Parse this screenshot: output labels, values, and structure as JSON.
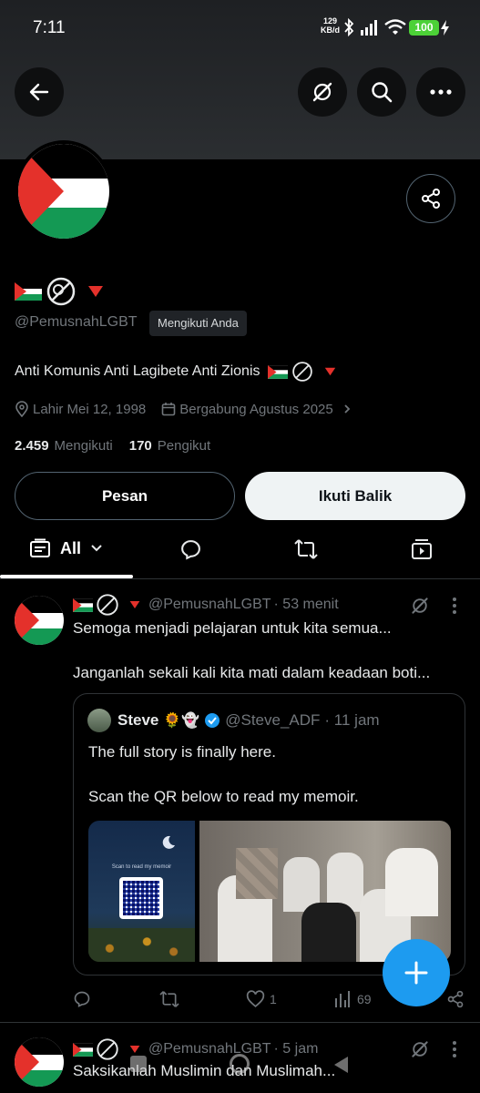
{
  "status_bar": {
    "time": "7:11",
    "net_speed": "129",
    "net_unit": "KB/d",
    "battery": "100"
  },
  "header": {
    "back_icon": "arrow-left-icon",
    "grok_icon": "grok-icon",
    "search_icon": "search-icon",
    "more_icon": "more-horizontal-icon"
  },
  "profile": {
    "handle": "@PemusnahLGBT",
    "follows_you": "Mengikuti Anda",
    "bio": "Anti Komunis Anti Lagibete Anti Zionis",
    "birth": "Lahir Mei 12, 1998",
    "joined": "Bergabung Agustus 2025",
    "following_count": "2.459",
    "following_label": "Mengikuti",
    "followers_count": "170",
    "followers_label": "Pengikut",
    "message_button": "Pesan",
    "follow_back_button": "Ikuti Balik"
  },
  "tabs": {
    "all_label": "All"
  },
  "posts": [
    {
      "handle": "@PemusnahLGBT",
      "time": "· 53 menit",
      "line1": "Semoga menjadi pelajaran untuk kita semua...",
      "line2": "Janganlah sekali kali kita mati dalam keadaan boti...",
      "quote": {
        "name": "Steve",
        "emojis": "🌻👻",
        "handle": "@Steve_ADF",
        "time": "· 11 jam",
        "line1": "The full story is finally here.",
        "line2": "Scan the QR below to read my memoir.",
        "qr_caption": "Scan to read my memoir"
      },
      "actions": {
        "reply": "",
        "repost": "",
        "likes": "1",
        "views": "69"
      }
    },
    {
      "handle": "@PemusnahLGBT",
      "time": "· 5 jam",
      "line1": "Saksikanlah Muslimin dan Muslimah..."
    }
  ],
  "colors": {
    "accent": "#1d9bf0",
    "verified": "#1d9bf0",
    "muted": "#71767b",
    "flag_red": "#e4312b",
    "flag_green": "#149954"
  }
}
